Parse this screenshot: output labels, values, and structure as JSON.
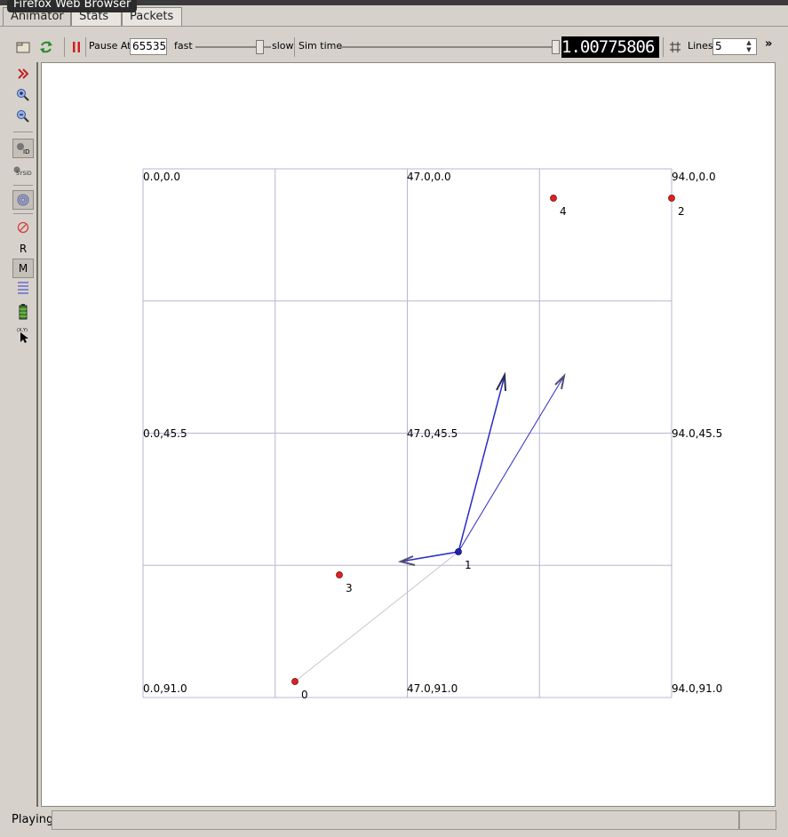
{
  "window": {
    "tooltip": "Firefox Web Browser"
  },
  "tabs": [
    {
      "label": "Animator"
    },
    {
      "label": "Stats"
    },
    {
      "label": "Packets"
    }
  ],
  "toolbar": {
    "pause_at_label": "Pause At",
    "pause_at_value": "65535",
    "fast_label": "fast",
    "slow_label": "slow",
    "speed_level": 0.9,
    "sim_time_label": "Sim time",
    "sim_time_progress": 1.0,
    "sim_time_value": "1.00775806",
    "lines_label": "Lines",
    "lines_value": "5",
    "more_label": "»"
  },
  "sidebar": {
    "items": [
      {
        "icon": "fast-forward-icon"
      },
      {
        "icon": "zoom-in-icon"
      },
      {
        "icon": "zoom-out-icon"
      },
      {
        "icon": "node-id-icon",
        "label": "ID"
      },
      {
        "icon": "sysid-icon",
        "label": "SYSID"
      },
      {
        "icon": "spiral-icon"
      },
      {
        "icon": "stop-icon"
      },
      {
        "icon": "r-icon",
        "label": "R"
      },
      {
        "icon": "m-icon",
        "label": "M"
      },
      {
        "icon": "lines-icon"
      },
      {
        "icon": "battery-icon"
      },
      {
        "icon": "pointer-xy-icon",
        "label": "(X,Y)"
      }
    ]
  },
  "canvas": {
    "grid_color": "#b7b7d2",
    "node_color": "#e02020",
    "active_node_color": "#2020c0",
    "arrow_color": "#2b2bc8",
    "corner_labels": {
      "tl": "0.0,0.0",
      "tm": "47.0,0.0",
      "tr": "94.0,0.0",
      "ml": "0.0,45.5",
      "mm": "47.0,45.5",
      "mr": "94.0,45.5",
      "bl": "0.0,91.0",
      "bm": "47.0,91.0",
      "br": "94.0,91.0"
    },
    "nodes": [
      {
        "id": "0"
      },
      {
        "id": "1"
      },
      {
        "id": "2"
      },
      {
        "id": "3"
      },
      {
        "id": "4"
      }
    ]
  },
  "status": {
    "text": "Playing"
  }
}
